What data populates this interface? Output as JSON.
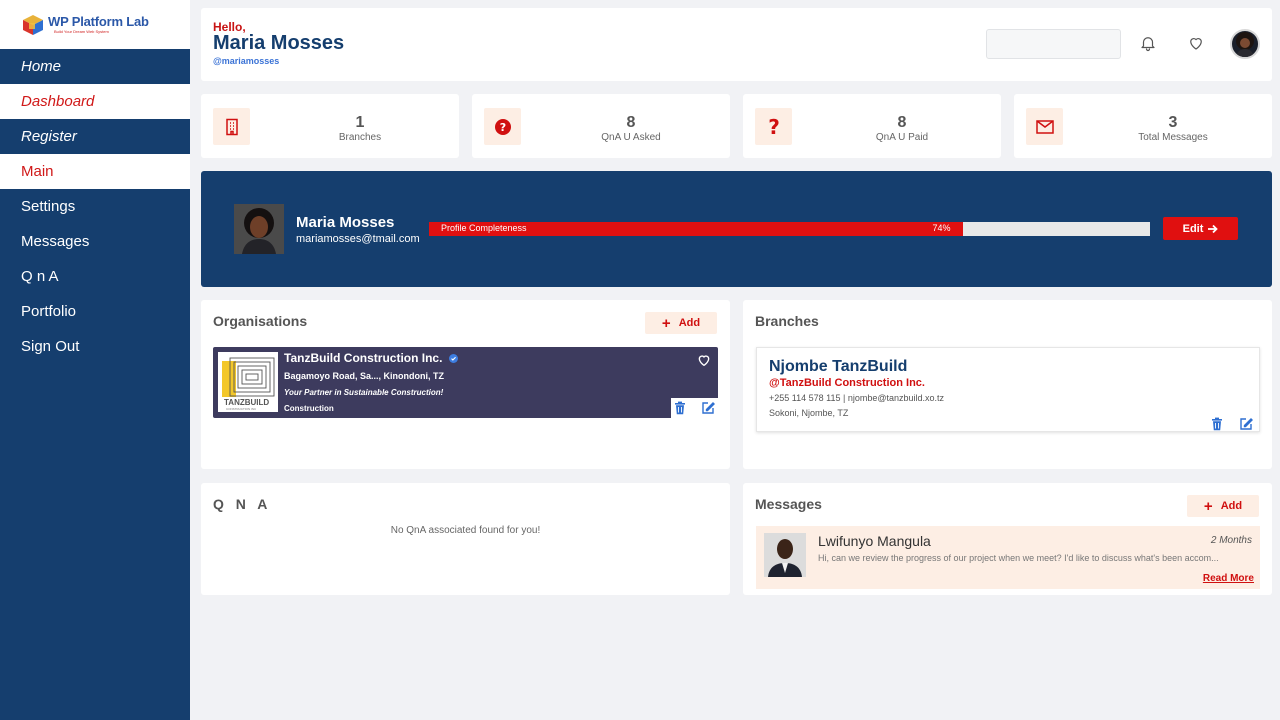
{
  "brand": {
    "name": "WP Platform Lab",
    "tagline": "Build Your Dream Web System"
  },
  "nav": [
    {
      "label": "Home"
    },
    {
      "label": "Dashboard"
    },
    {
      "label": "Register"
    },
    {
      "label": "Main"
    },
    {
      "label": "Settings"
    },
    {
      "label": "Messages"
    },
    {
      "label": "Q n A"
    },
    {
      "label": "Portfolio"
    },
    {
      "label": "Sign Out"
    }
  ],
  "header": {
    "greeting": "Hello,",
    "name": "Maria Mosses",
    "handle": "@mariamosses",
    "search_placeholder": ""
  },
  "stats": [
    {
      "value": "1",
      "label": "Branches",
      "icon": "building-icon"
    },
    {
      "value": "8",
      "label": "QnA U Asked",
      "icon": "question-circle-icon"
    },
    {
      "value": "8",
      "label": "QnA U Paid",
      "icon": "question-mark-icon"
    },
    {
      "value": "3",
      "label": "Total Messages",
      "icon": "envelope-icon"
    }
  ],
  "profile": {
    "name": "Maria Mosses",
    "email": "mariamosses@tmail.com",
    "completeness_label": "Profile Completeness",
    "completeness_pct": 74,
    "completeness_text": "74%",
    "edit_label": "Edit"
  },
  "organisations": {
    "title": "Organisations",
    "add_label": "Add",
    "items": [
      {
        "name": "TanzBuild Construction Inc.",
        "address": "Bagamoyo Road, Sa..., Kinondoni, TZ",
        "tagline": "Your Partner in Sustainable Construction!",
        "category": "Construction",
        "logo_text": "TANZBUILD",
        "logo_sub": "CONSTRUCTION INC"
      }
    ]
  },
  "branches": {
    "title": "Branches",
    "items": [
      {
        "name": "Njombe TanzBuild",
        "org": "@TanzBuild Construction Inc.",
        "contact": "+255 114 578 115 | njombe@tanzbuild.xo.tz",
        "location": "Sokoni, Njombe, TZ"
      }
    ]
  },
  "qna": {
    "title": "Q N A",
    "empty": "No QnA associated found for you!"
  },
  "messages": {
    "title": "Messages",
    "add_label": "Add",
    "items": [
      {
        "sender": "Lwifunyo Mangula",
        "time": "2 Months",
        "preview": "Hi, can we review the progress of our project when we meet? I'd like to discuss what's been accom...",
        "read_more": "Read More"
      }
    ]
  },
  "colors": {
    "navy": "#153e6e",
    "red": "#e01010",
    "peach": "#fdeee4",
    "org_card": "#3d3b5e"
  }
}
